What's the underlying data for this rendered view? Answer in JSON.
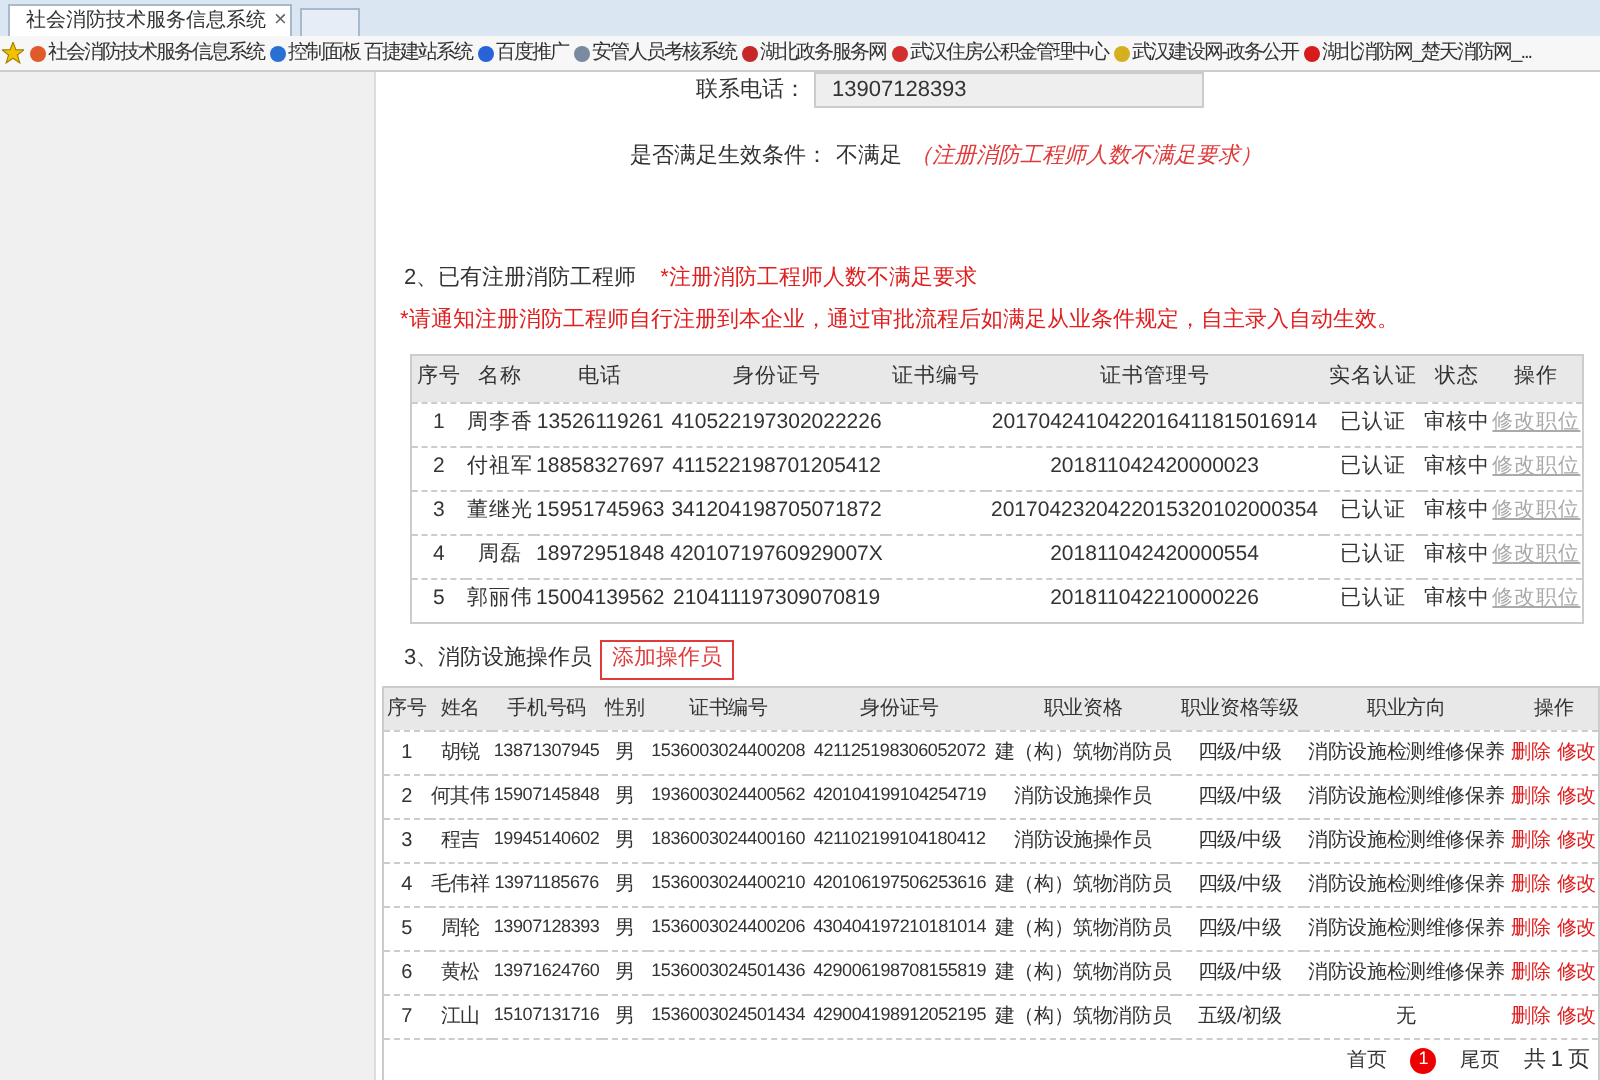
{
  "browser": {
    "tabs": [
      {
        "title": "社会消防技术服务信息系统",
        "close": "×",
        "selected": true
      }
    ],
    "bookmarks": [
      {
        "label": "社会消防技术服务信息系统",
        "color": "#e05a2a"
      },
      {
        "label": "控制面板 百捷建站系统",
        "color": "#2a6fd6"
      },
      {
        "label": "百度推广",
        "color": "#2a62d9"
      },
      {
        "label": "安管人员考核系统",
        "color": "#7a8aa0"
      },
      {
        "label": "湖北政务服务网",
        "color": "#c62828"
      },
      {
        "label": "武汉住房公积金管理中心",
        "color": "#d32f2f"
      },
      {
        "label": "武汉建设网-政务公开",
        "color": "#d4b021"
      },
      {
        "label": "湖北消防网_楚天消防网_...",
        "color": "#d81b1b"
      }
    ]
  },
  "contact": {
    "label": "联系电话：",
    "value": "13907128393"
  },
  "condition": {
    "label": "是否满足生效条件：",
    "value": "不满足",
    "note": "（注册消防工程师人数不满足要求）"
  },
  "engineers": {
    "heading": "2、已有注册消防工程师",
    "warning": "*注册消防工程师人数不满足要求",
    "notice": "*请通知注册消防工程师自行注册到本企业，通过审批流程后如满足从业条件规定，自主录入自动生效。",
    "columns": [
      "序号",
      "名称",
      "电话",
      "身份证号",
      "证书编号",
      "证书管理号",
      "实名认证",
      "状态",
      "操作"
    ],
    "rows": [
      {
        "no": "1",
        "name": "周李香",
        "phone": "13526119261",
        "id": "410522197302022226",
        "cert_mgmt": "2017042410422016411815016914",
        "verified": "已认证",
        "status": "审核中",
        "action": "修改职位"
      },
      {
        "no": "2",
        "name": "付祖军",
        "phone": "18858327697",
        "id": "411522198701205412",
        "cert_mgmt": "201811042420000023",
        "verified": "已认证",
        "status": "审核中",
        "action": "修改职位"
      },
      {
        "no": "3",
        "name": "董继光",
        "phone": "15951745963",
        "id": "341204198705071872",
        "cert_mgmt": "2017042320422015320102000354",
        "verified": "已认证",
        "status": "审核中",
        "action": "修改职位"
      },
      {
        "no": "4",
        "name": "周磊",
        "phone": "18972951848",
        "id": "42010719760929007X",
        "cert_mgmt": "201811042420000554",
        "verified": "已认证",
        "status": "审核中",
        "action": "修改职位"
      },
      {
        "no": "5",
        "name": "郭丽伟",
        "phone": "15004139562",
        "id": "210411197309070819",
        "cert_mgmt": "201811042210000226",
        "verified": "已认证",
        "status": "审核中",
        "action": "修改职位"
      }
    ]
  },
  "operators": {
    "heading": "3、消防设施操作员",
    "add_button": "添加操作员",
    "columns": [
      "序号",
      "姓名",
      "手机号码",
      "性别",
      "证书编号",
      "身份证号",
      "职业资格",
      "职业资格等级",
      "职业方向",
      "操作"
    ],
    "rows": [
      {
        "no": "1",
        "name": "胡锐",
        "phone": "13871307945",
        "gender": "男",
        "cert": "1536003024400208",
        "id": "421125198306052072",
        "qualification": "建（构）筑物消防员",
        "level": "四级/中级",
        "direction": "消防设施检测维修保养",
        "delete": "删除",
        "edit": "修改"
      },
      {
        "no": "2",
        "name": "何其伟",
        "phone": "15907145848",
        "gender": "男",
        "cert": "1936003024400562",
        "id": "420104199104254719",
        "qualification": "消防设施操作员",
        "level": "四级/中级",
        "direction": "消防设施检测维修保养",
        "delete": "删除",
        "edit": "修改"
      },
      {
        "no": "3",
        "name": "程吉",
        "phone": "19945140602",
        "gender": "男",
        "cert": "1836003024400160",
        "id": "421102199104180412",
        "qualification": "消防设施操作员",
        "level": "四级/中级",
        "direction": "消防设施检测维修保养",
        "delete": "删除",
        "edit": "修改"
      },
      {
        "no": "4",
        "name": "毛伟祥",
        "phone": "13971185676",
        "gender": "男",
        "cert": "1536003024400210",
        "id": "420106197506253616",
        "qualification": "建（构）筑物消防员",
        "level": "四级/中级",
        "direction": "消防设施检测维修保养",
        "delete": "删除",
        "edit": "修改"
      },
      {
        "no": "5",
        "name": "周轮",
        "phone": "13907128393",
        "gender": "男",
        "cert": "1536003024400206",
        "id": "430404197210181014",
        "qualification": "建（构）筑物消防员",
        "level": "四级/中级",
        "direction": "消防设施检测维修保养",
        "delete": "删除",
        "edit": "修改"
      },
      {
        "no": "6",
        "name": "黄松",
        "phone": "13971624760",
        "gender": "男",
        "cert": "1536003024501436",
        "id": "429006198708155819",
        "qualification": "建（构）筑物消防员",
        "level": "四级/中级",
        "direction": "消防设施检测维修保养",
        "delete": "删除",
        "edit": "修改"
      },
      {
        "no": "7",
        "name": "江山",
        "phone": "15107131716",
        "gender": "男",
        "cert": "1536003024501434",
        "id": "429004198912052195",
        "qualification": "建（构）筑物消防员",
        "level": "五级/初级",
        "direction": "无",
        "delete": "删除",
        "edit": "修改"
      }
    ],
    "pagination": {
      "first": "首页",
      "pages": [
        {
          "label": "1",
          "selected": true
        }
      ],
      "last": "尾页",
      "total": "共 1 页"
    }
  }
}
